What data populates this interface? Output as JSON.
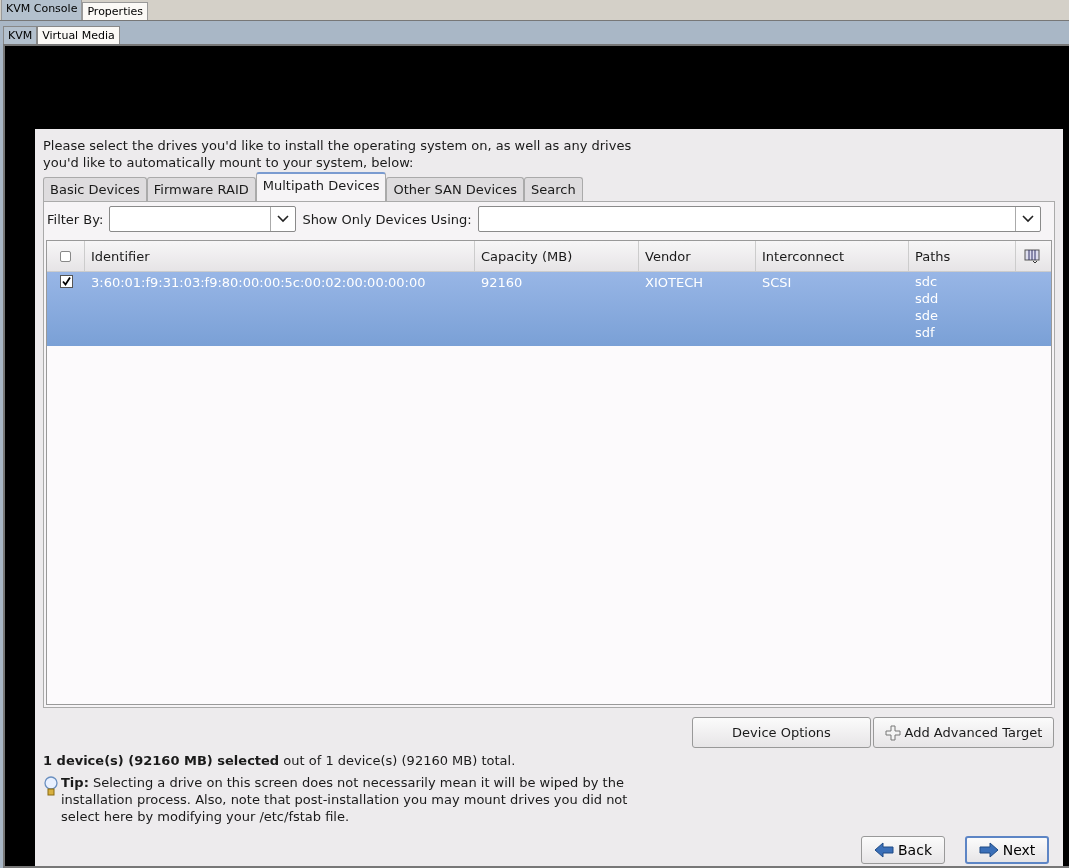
{
  "outer_tabs": [
    {
      "label": "KVM Console",
      "selected": true
    },
    {
      "label": "Properties",
      "selected": false
    }
  ],
  "inner_tabs": [
    {
      "label": "KVM",
      "selected": true
    },
    {
      "label": "Virtual Media",
      "selected": false
    }
  ],
  "dialog": {
    "intro": "Please select the drives you'd like to install the operating system on, as well as any drives you'd like to automatically mount to your system, below:",
    "tabs": [
      {
        "label": "Basic Devices",
        "selected": false
      },
      {
        "label": "Firmware RAID",
        "selected": false
      },
      {
        "label": "Multipath Devices",
        "selected": true
      },
      {
        "label": "Other SAN Devices",
        "selected": false
      },
      {
        "label": "Search",
        "selected": false
      }
    ],
    "filter_by": {
      "label": "Filter By:"
    },
    "show_only": {
      "label": "Show Only Devices Using:"
    },
    "table": {
      "all_checked": false,
      "columns": [
        "Identifier",
        "Capacity (MB)",
        "Vendor",
        "Interconnect",
        "Paths"
      ],
      "rows": [
        {
          "checked": true,
          "selected": true,
          "identifier": "3:60:01:f9:31:03:f9:80:00:00:5c:00:02:00:00:00:00",
          "capacity": "92160",
          "vendor": "XIOTECH",
          "interconnect": "SCSI",
          "paths": [
            "sdc",
            "sdd",
            "sde",
            "sdf"
          ]
        }
      ]
    },
    "buttons": [
      "Device Options",
      "Add Advanced Target"
    ],
    "summary": "**1 device(s) (92160 MB) selected** out of 1 device(s) (92160 MB) total.",
    "tip": "**Tip:** Selecting a drive on this screen does not necessarily mean it will be wiped by the installation process.  Also, note that post-installation you may mount drives you did not select here by modifying your /etc/fstab file.",
    "nav": [
      "Back",
      "Next"
    ]
  }
}
